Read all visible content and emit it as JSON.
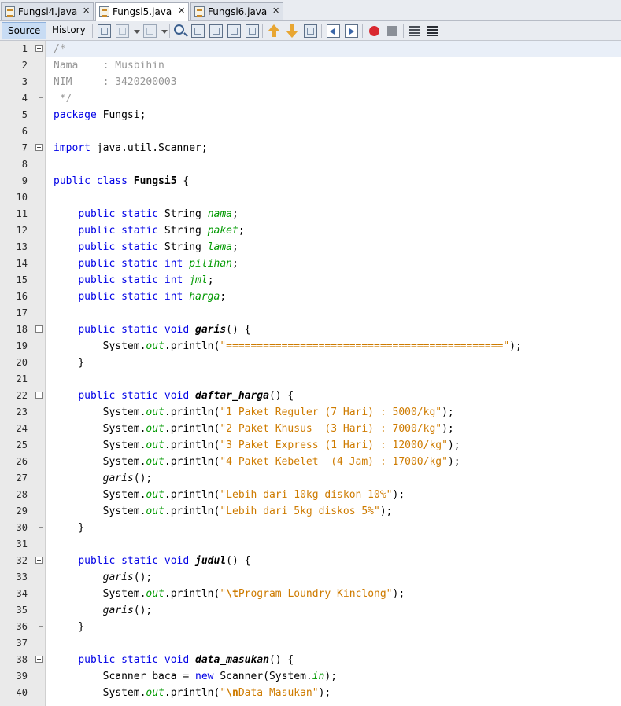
{
  "tabs": [
    {
      "label": "Fungsi4.java",
      "active": false
    },
    {
      "label": "Fungsi5.java",
      "active": true
    },
    {
      "label": "Fungsi6.java",
      "active": false
    }
  ],
  "close_glyph": "✕",
  "toolbar": {
    "source_label": "Source",
    "history_label": "History",
    "icons": [
      "last-edit-icon",
      "back-icon",
      "forward-icon",
      "find-icon",
      "find-previous-icon",
      "find-next-icon",
      "toggle-highlight-icon",
      "toggle-rectangular-selection-icon",
      "previous-bookmark-icon",
      "next-bookmark-icon",
      "toggle-bookmark-icon",
      "shift-left-icon",
      "shift-right-icon",
      "start-macro-icon",
      "stop-macro-icon",
      "comment-icon",
      "uncomment-icon"
    ]
  },
  "colors": {
    "keyword": "#0000e6",
    "string": "#ce7b00",
    "field": "#009900",
    "comment": "#969696",
    "current_line": "#e9eff8"
  },
  "editor": {
    "lines": [
      {
        "n": "1",
        "fold": "open",
        "segs": [
          [
            "c-cmt",
            "/*"
          ]
        ]
      },
      {
        "n": "2",
        "segs": [
          [
            "c-cmt",
            "Nama    : Musbihin"
          ]
        ]
      },
      {
        "n": "3",
        "segs": [
          [
            "c-cmt",
            "NIM     : 3420200003"
          ]
        ]
      },
      {
        "n": "4",
        "fold": "end",
        "segs": [
          [
            "c-cmt",
            " */"
          ]
        ]
      },
      {
        "n": "5",
        "segs": [
          [
            "c-kw",
            "package"
          ],
          [
            "",
            " Fungsi;"
          ]
        ]
      },
      {
        "n": "6",
        "segs": []
      },
      {
        "n": "7",
        "fold": "single",
        "segs": [
          [
            "c-kw",
            "import"
          ],
          [
            "",
            " java.util.Scanner;"
          ]
        ]
      },
      {
        "n": "8",
        "segs": []
      },
      {
        "n": "9",
        "segs": [
          [
            "c-kw",
            "public class"
          ],
          [
            "",
            " "
          ],
          [
            "c-cls",
            "Fungsi5"
          ],
          [
            "",
            " {"
          ]
        ]
      },
      {
        "n": "10",
        "segs": []
      },
      {
        "n": "11",
        "segs": [
          [
            "",
            "    "
          ],
          [
            "c-kw",
            "public static"
          ],
          [
            "",
            " String "
          ],
          [
            "c-fld",
            "nama"
          ],
          [
            "",
            ";"
          ]
        ]
      },
      {
        "n": "12",
        "segs": [
          [
            "",
            "    "
          ],
          [
            "c-kw",
            "public static"
          ],
          [
            "",
            " String "
          ],
          [
            "c-fld",
            "paket"
          ],
          [
            "",
            ";"
          ]
        ]
      },
      {
        "n": "13",
        "segs": [
          [
            "",
            "    "
          ],
          [
            "c-kw",
            "public static"
          ],
          [
            "",
            " String "
          ],
          [
            "c-fld",
            "lama"
          ],
          [
            "",
            ";"
          ]
        ]
      },
      {
        "n": "14",
        "segs": [
          [
            "",
            "    "
          ],
          [
            "c-kw",
            "public static int"
          ],
          [
            "",
            " "
          ],
          [
            "c-fld",
            "pilihan"
          ],
          [
            "",
            ";"
          ]
        ]
      },
      {
        "n": "15",
        "segs": [
          [
            "",
            "    "
          ],
          [
            "c-kw",
            "public static int"
          ],
          [
            "",
            " "
          ],
          [
            "c-fld",
            "jml"
          ],
          [
            "",
            ";"
          ]
        ]
      },
      {
        "n": "16",
        "segs": [
          [
            "",
            "    "
          ],
          [
            "c-kw",
            "public static int"
          ],
          [
            "",
            " "
          ],
          [
            "c-fld",
            "harga"
          ],
          [
            "",
            ";"
          ]
        ]
      },
      {
        "n": "17",
        "segs": []
      },
      {
        "n": "18",
        "fold": "open",
        "segs": [
          [
            "",
            "    "
          ],
          [
            "c-kw",
            "public static void"
          ],
          [
            "",
            " "
          ],
          [
            "c-mth",
            "garis"
          ],
          [
            "",
            "() {"
          ]
        ]
      },
      {
        "n": "19",
        "segs": [
          [
            "",
            "        System."
          ],
          [
            "c-out",
            "out"
          ],
          [
            "",
            ".println("
          ],
          [
            "c-str",
            "\"=============================================\""
          ],
          [
            "",
            ");"
          ]
        ]
      },
      {
        "n": "20",
        "fold": "end",
        "segs": [
          [
            "",
            "    }"
          ]
        ]
      },
      {
        "n": "21",
        "segs": []
      },
      {
        "n": "22",
        "fold": "open",
        "segs": [
          [
            "",
            "    "
          ],
          [
            "c-kw",
            "public static void"
          ],
          [
            "",
            " "
          ],
          [
            "c-mth",
            "daftar_harga"
          ],
          [
            "",
            "() {"
          ]
        ]
      },
      {
        "n": "23",
        "segs": [
          [
            "",
            "        System."
          ],
          [
            "c-out",
            "out"
          ],
          [
            "",
            ".println("
          ],
          [
            "c-str",
            "\"1 Paket Reguler (7 Hari) : 5000/kg\""
          ],
          [
            "",
            ");"
          ]
        ]
      },
      {
        "n": "24",
        "segs": [
          [
            "",
            "        System."
          ],
          [
            "c-out",
            "out"
          ],
          [
            "",
            ".println("
          ],
          [
            "c-str",
            "\"2 Paket Khusus  (3 Hari) : 7000/kg\""
          ],
          [
            "",
            ");"
          ]
        ]
      },
      {
        "n": "25",
        "segs": [
          [
            "",
            "        System."
          ],
          [
            "c-out",
            "out"
          ],
          [
            "",
            ".println("
          ],
          [
            "c-str",
            "\"3 Paket Express (1 Hari) : 12000/kg\""
          ],
          [
            "",
            ");"
          ]
        ]
      },
      {
        "n": "26",
        "segs": [
          [
            "",
            "        System."
          ],
          [
            "c-out",
            "out"
          ],
          [
            "",
            ".println("
          ],
          [
            "c-str",
            "\"4 Paket Kebelet  (4 Jam) : 17000/kg\""
          ],
          [
            "",
            ");"
          ]
        ]
      },
      {
        "n": "27",
        "segs": [
          [
            "",
            "        "
          ],
          [
            "c-call",
            "garis"
          ],
          [
            "",
            "();"
          ]
        ]
      },
      {
        "n": "28",
        "segs": [
          [
            "",
            "        System."
          ],
          [
            "c-out",
            "out"
          ],
          [
            "",
            ".println("
          ],
          [
            "c-str",
            "\"Lebih dari 10kg diskon 10%\""
          ],
          [
            "",
            ");"
          ]
        ]
      },
      {
        "n": "29",
        "segs": [
          [
            "",
            "        System."
          ],
          [
            "c-out",
            "out"
          ],
          [
            "",
            ".println("
          ],
          [
            "c-str",
            "\"Lebih dari 5kg diskos 5%\""
          ],
          [
            "",
            ");"
          ]
        ]
      },
      {
        "n": "30",
        "fold": "end",
        "segs": [
          [
            "",
            "    }"
          ]
        ]
      },
      {
        "n": "31",
        "segs": []
      },
      {
        "n": "32",
        "fold": "open",
        "segs": [
          [
            "",
            "    "
          ],
          [
            "c-kw",
            "public static void"
          ],
          [
            "",
            " "
          ],
          [
            "c-mth",
            "judul"
          ],
          [
            "",
            "() {"
          ]
        ]
      },
      {
        "n": "33",
        "segs": [
          [
            "",
            "        "
          ],
          [
            "c-call",
            "garis"
          ],
          [
            "",
            "();"
          ]
        ]
      },
      {
        "n": "34",
        "segs": [
          [
            "",
            "        System."
          ],
          [
            "c-out",
            "out"
          ],
          [
            "",
            ".println("
          ],
          [
            "c-str",
            "\""
          ],
          [
            "c-esc",
            "\\t"
          ],
          [
            "c-str",
            "Program Loundry Kinclong\""
          ],
          [
            "",
            ");"
          ]
        ]
      },
      {
        "n": "35",
        "segs": [
          [
            "",
            "        "
          ],
          [
            "c-call",
            "garis"
          ],
          [
            "",
            "();"
          ]
        ]
      },
      {
        "n": "36",
        "fold": "end",
        "segs": [
          [
            "",
            "    }"
          ]
        ]
      },
      {
        "n": "37",
        "segs": []
      },
      {
        "n": "38",
        "fold": "open",
        "segs": [
          [
            "",
            "    "
          ],
          [
            "c-kw",
            "public static void"
          ],
          [
            "",
            " "
          ],
          [
            "c-mth",
            "data_masukan"
          ],
          [
            "",
            "() {"
          ]
        ]
      },
      {
        "n": "39",
        "segs": [
          [
            "",
            "        Scanner baca = "
          ],
          [
            "c-kw",
            "new"
          ],
          [
            "",
            " Scanner(System."
          ],
          [
            "c-out",
            "in"
          ],
          [
            "",
            ");"
          ]
        ]
      },
      {
        "n": "40",
        "segs": [
          [
            "",
            "        System."
          ],
          [
            "c-out",
            "out"
          ],
          [
            "",
            ".println("
          ],
          [
            "c-str",
            "\""
          ],
          [
            "c-esc",
            "\\n"
          ],
          [
            "c-str",
            "Data Masukan\""
          ],
          [
            "",
            ");"
          ]
        ]
      }
    ]
  }
}
